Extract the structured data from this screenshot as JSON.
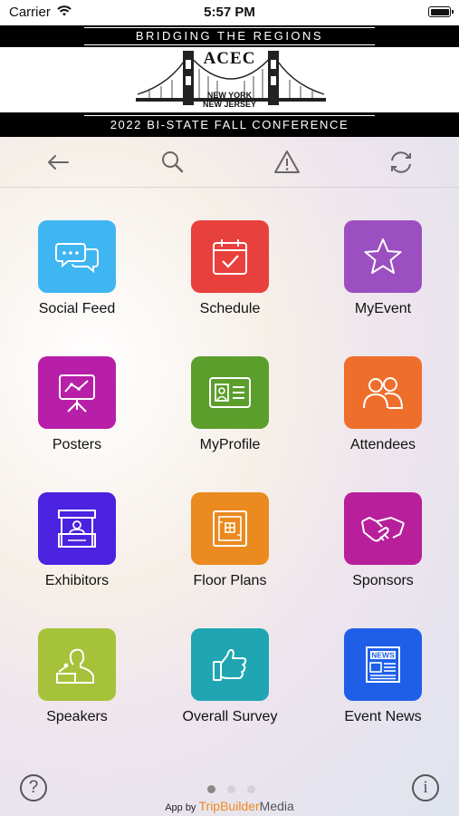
{
  "status_bar": {
    "carrier": "Carrier",
    "time": "5:57 PM"
  },
  "banner": {
    "tagline": "BRIDGING THE REGIONS",
    "org": "ACEC",
    "region_line1": "NEW YORK",
    "region_line2": "NEW JERSEY",
    "event_title": "2022 BI-STATE FALL CONFERENCE"
  },
  "toolbar": {
    "back_icon": "arrow-left-icon",
    "search_icon": "search-icon",
    "alert_icon": "warning-icon",
    "refresh_icon": "refresh-icon"
  },
  "tiles": [
    {
      "label": "Social Feed",
      "icon": "chat-bubbles-icon",
      "color": "#3fb6f2"
    },
    {
      "label": "Schedule",
      "icon": "calendar-check-icon",
      "color": "#e8403c"
    },
    {
      "label": "MyEvent",
      "icon": "star-icon",
      "color": "#9b4fc0"
    },
    {
      "label": "Posters",
      "icon": "presentation-board-icon",
      "color": "#b81fa8"
    },
    {
      "label": "MyProfile",
      "icon": "id-card-icon",
      "color": "#5c9e2c"
    },
    {
      "label": "Attendees",
      "icon": "people-icon",
      "color": "#ee6e2c"
    },
    {
      "label": "Exhibitors",
      "icon": "booth-icon",
      "color": "#4a22e0"
    },
    {
      "label": "Floor Plans",
      "icon": "floor-plan-icon",
      "color": "#ea8a1f"
    },
    {
      "label": "Sponsors",
      "icon": "handshake-icon",
      "color": "#b81f9a"
    },
    {
      "label": "Speakers",
      "icon": "speaker-podium-icon",
      "color": "#a6c23a"
    },
    {
      "label": "Overall Survey",
      "icon": "thumbs-up-icon",
      "color": "#1fa6b2"
    },
    {
      "label": "Event News",
      "icon": "newspaper-icon",
      "color": "#1f5fe8"
    }
  ],
  "footer": {
    "help": "?",
    "info": "i",
    "pages": 3,
    "current_page": 1,
    "powered_prefix": "App by",
    "brand_part1": "TripBuilder",
    "brand_part2": "Media"
  }
}
